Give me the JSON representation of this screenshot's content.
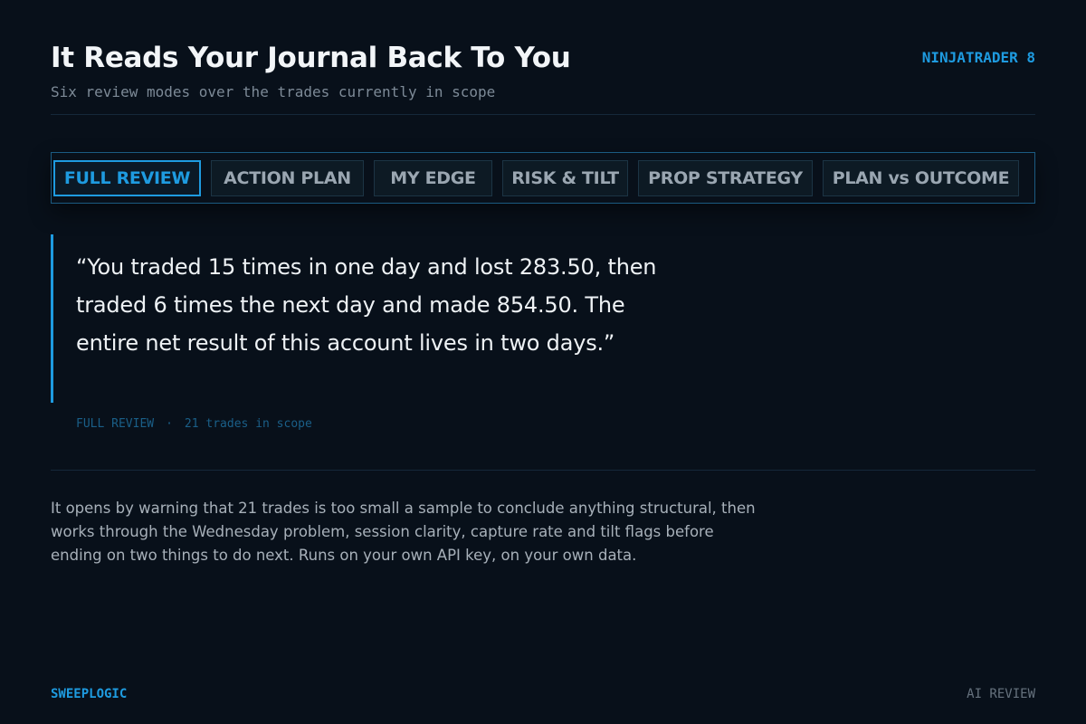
{
  "header": {
    "title": "It Reads Your Journal Back To You",
    "subtitle": "Six review modes over the trades currently in scope",
    "platform": "NINJATRADER 8"
  },
  "tabs": [
    {
      "label": "FULL REVIEW",
      "active": true
    },
    {
      "label": "ACTION PLAN",
      "active": false
    },
    {
      "label": "MY EDGE",
      "active": false
    },
    {
      "label": "RISK & TILT",
      "active": false
    },
    {
      "label": "PROP STRATEGY",
      "active": false
    },
    {
      "label": "PLAN vs OUTCOME",
      "active": false
    }
  ],
  "quote": {
    "text": "“You traded 15 times in one day and lost 283.50, then traded 6 times the next day and made 854.50. The entire net result of this account lives in two days.”",
    "mode": "FULL REVIEW",
    "separator": "·",
    "scope": "21 trades in scope"
  },
  "description": "It opens by warning that 21 trades is too small a sample to conclude anything structural, then works through the Wednesday problem, session clarity, capture rate and tilt flags before ending on two things to do next. Runs on your own API key, on your own data.",
  "footer": {
    "brand": "SWEEPLOGIC",
    "section": "AI REVIEW"
  },
  "colors": {
    "background": "#08101a",
    "accent": "#1e9be0",
    "text": "#eef2f5",
    "muted": "#7d8a97"
  }
}
